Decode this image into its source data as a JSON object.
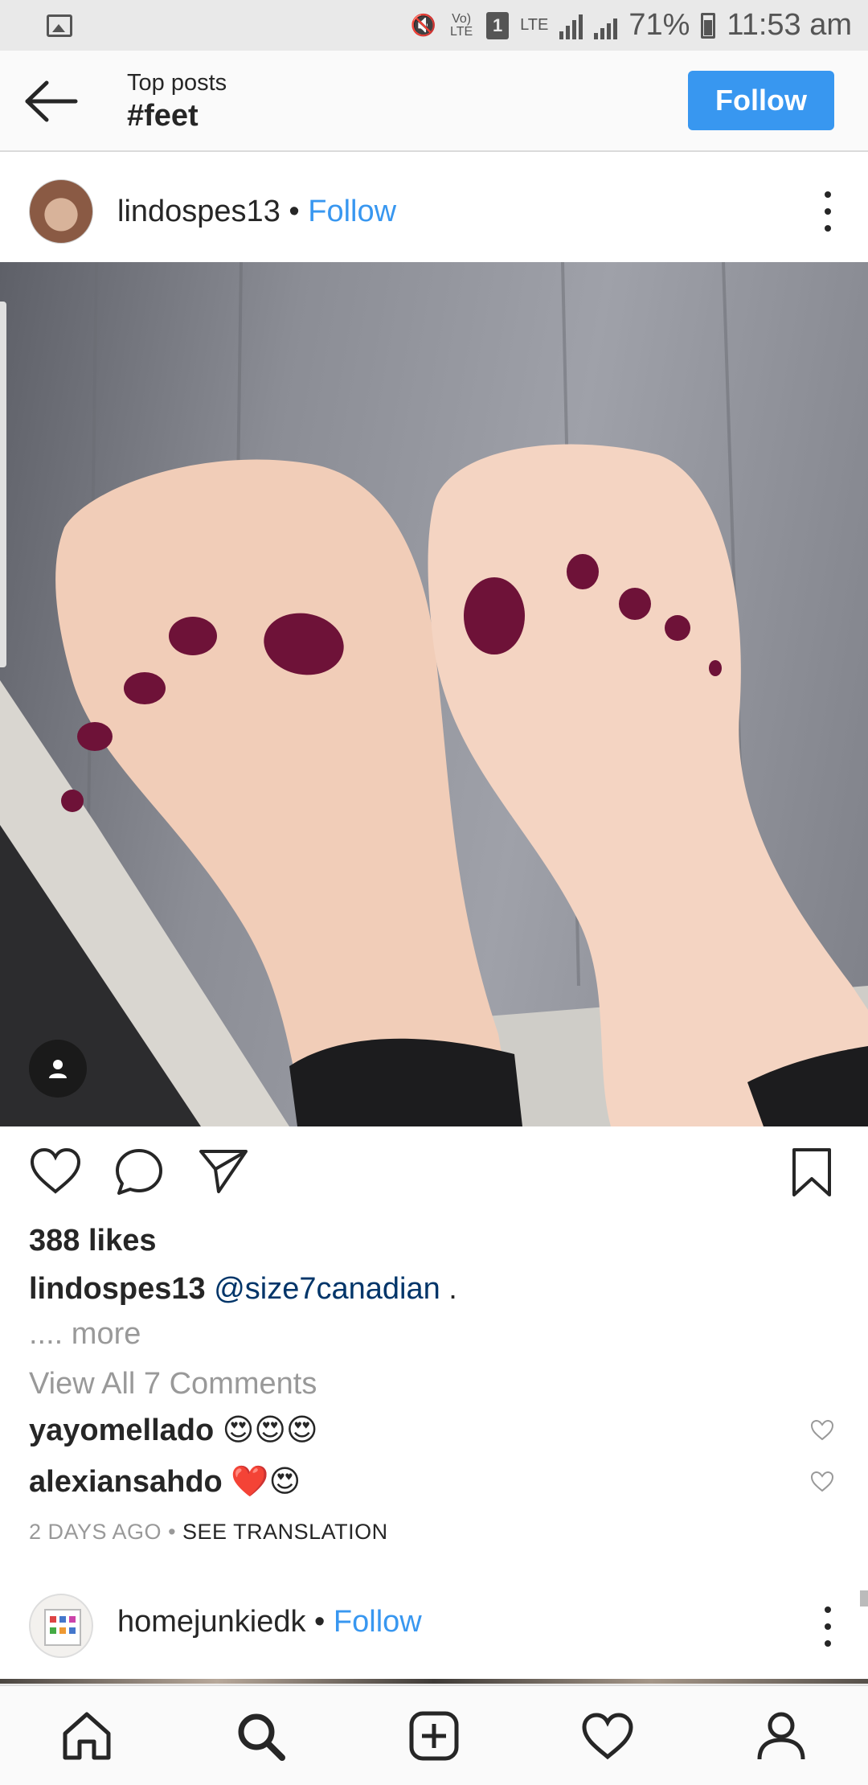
{
  "status_bar": {
    "icons": [
      "gallery-icon",
      "mute-icon",
      "volte-icon",
      "sim-icon",
      "lte-icon",
      "signal-icon",
      "signal-icon",
      "battery-icon"
    ],
    "volte": "Vo) LTE",
    "sim": "1",
    "lte": "LTE",
    "battery": "71%",
    "time": "11:53 am"
  },
  "header": {
    "subtitle": "Top posts",
    "title": "#feet",
    "follow_label": "Follow",
    "accent": "#3897f0"
  },
  "post": {
    "username": "lindospes13",
    "separator": " • ",
    "follow_label": "Follow",
    "likes": "388 likes",
    "caption_user": "lindospes13",
    "caption_mention": "@size7canadian",
    "caption_tail": " .",
    "more_prefix": ".... ",
    "more_label": "more",
    "view_all": "View All 7 Comments",
    "comments": [
      {
        "user": "yayomellado",
        "text": "😍😍😍"
      },
      {
        "user": "alexiansahdo",
        "text": "❤️😍"
      }
    ],
    "time_ago": "2 DAYS AGO",
    "meta_sep": " • ",
    "translate": "SEE TRANSLATION"
  },
  "next_post": {
    "username": "homejunkiedk",
    "separator": " • ",
    "follow_label": "Follow"
  },
  "bottom_nav": [
    "home-icon",
    "search-icon",
    "add-post-icon",
    "activity-heart-icon",
    "profile-icon"
  ]
}
